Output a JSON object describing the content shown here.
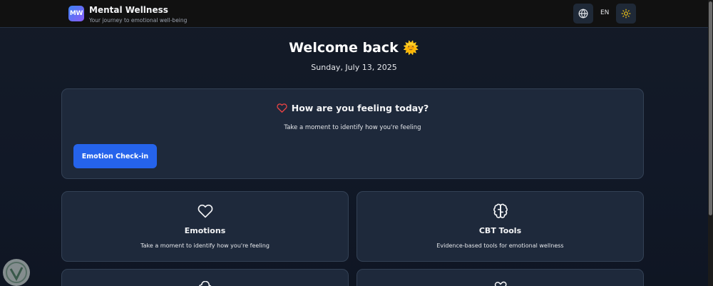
{
  "header": {
    "logo_text": "MW",
    "title": "Mental Wellness",
    "subtitle": "Your journey to emotional well-being",
    "language": "EN",
    "icons": [
      "globe-icon",
      "sun-icon"
    ]
  },
  "welcome": {
    "title": "Welcome back",
    "emoji": "🌞",
    "date": "Sunday, July 13, 2025"
  },
  "feeling_card": {
    "title": "How are you feeling today?",
    "subtitle": "Take a moment to identify how you're feeling",
    "button_label": "Emotion Check-in",
    "icon": "heart-icon"
  },
  "tiles": [
    {
      "title": "Emotions",
      "subtitle": "Take a moment to identify how you're feeling",
      "icon": "heart-icon"
    },
    {
      "title": "CBT Tools",
      "subtitle": "Evidence-based tools for emotional wellness",
      "icon": "brain-icon"
    }
  ],
  "colors": {
    "background": "#111827",
    "header": "#111111",
    "card": "#1e293b",
    "accent": "#2563eb",
    "heart": "#ef4444"
  }
}
